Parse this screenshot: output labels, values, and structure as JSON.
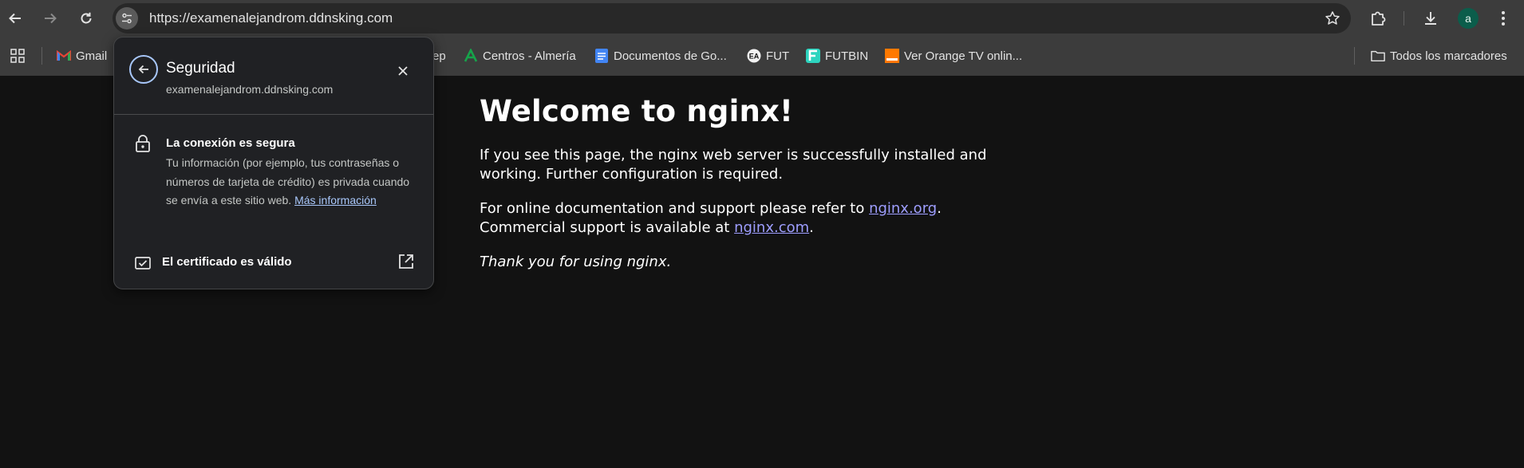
{
  "browser": {
    "url": "https://examenalejandrom.ddnsking.com",
    "profile_initial": "a",
    "icons": {
      "back": "arrow-left-icon",
      "forward": "arrow-right-icon",
      "reload": "reload-icon",
      "site_info": "tune-icon",
      "bookmark_star": "star-icon",
      "extensions": "puzzle-icon",
      "downloads": "download-icon",
      "menu": "kebab-menu-icon"
    }
  },
  "bookmarks": {
    "items": [
      {
        "label": "Gmail",
        "icon": "gmail-icon"
      },
      {
        "label": "ep",
        "icon": ""
      },
      {
        "label": "Centros - Almería",
        "icon": "junta-andalucia-icon"
      },
      {
        "label": "Documentos de Go...",
        "icon": "google-docs-icon"
      },
      {
        "label": "FUT",
        "icon": "ea-icon"
      },
      {
        "label": "FUTBIN",
        "icon": "futbin-icon"
      },
      {
        "label": "Ver Orange TV onlin...",
        "icon": "orange-icon"
      }
    ],
    "all_bookmarks_label": "Todos los marcadores"
  },
  "popup": {
    "title": "Seguridad",
    "domain": "examenalejandrom.ddnsking.com",
    "connection_title": "La conexión es segura",
    "connection_body": "Tu información (por ejemplo, tus contraseñas o números de tarjeta de crédito) es privada cuando se envía a este sitio web.",
    "more_info_link": "Más información",
    "certificate_label": "El certificado es válido"
  },
  "page": {
    "heading": "Welcome to nginx!",
    "para1": "If you see this page, the nginx web server is successfully installed and working. Further configuration is required.",
    "para2_prefix": "For online documentation and support please refer to ",
    "link1": "nginx.org",
    "para2_mid": ".",
    "para2_line2": "Commercial support is available at ",
    "link2": "nginx.com",
    "para2_end": ".",
    "thanks": "Thank you for using nginx."
  },
  "colors": {
    "toolbar_bg": "#3c3c3c",
    "page_bg": "#121212",
    "link": "#9e9eff",
    "popup_accent": "#a8c7fa",
    "avatar_bg": "#0b5d4b"
  }
}
